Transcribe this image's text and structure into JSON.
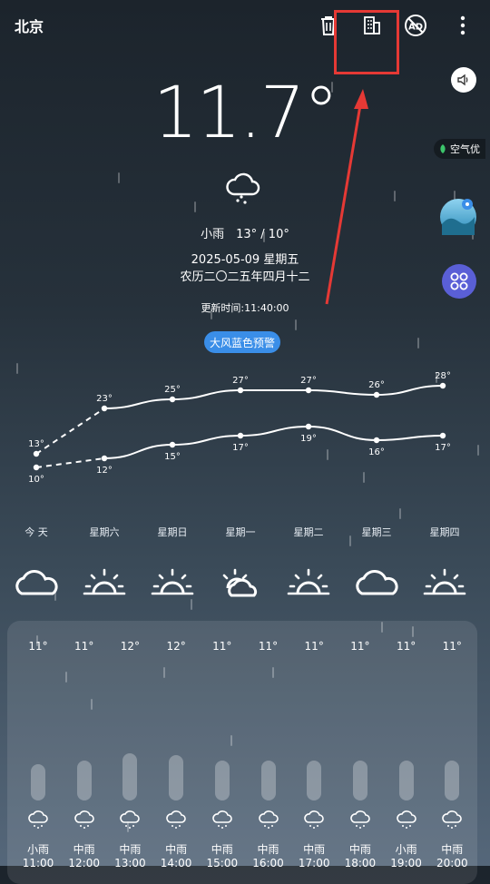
{
  "header": {
    "city": "北京",
    "icons": [
      "delete-icon",
      "building-icon",
      "ad-off-icon",
      "more-vert-icon"
    ]
  },
  "current": {
    "temperature": "11.7°",
    "condition_range": "小雨　13° / 10°",
    "date_weekday": "2025-05-09 星期五",
    "lunar": "农历二〇二五年四月十二",
    "updated": "更新时间:11:40:00",
    "warning": "大风蓝色预警",
    "air_quality": "空气优"
  },
  "daily": [
    {
      "label": "今 天",
      "high": "13°",
      "low": "10°",
      "icon": "cloud"
    },
    {
      "label": "星期六",
      "high": "23°",
      "low": "12°",
      "icon": "sun-cloud"
    },
    {
      "label": "星期日",
      "high": "25°",
      "low": "15°",
      "icon": "sun-cloud"
    },
    {
      "label": "星期一",
      "high": "27°",
      "low": "17°",
      "icon": "sun-cloud-partly"
    },
    {
      "label": "星期二",
      "high": "27°",
      "low": "19°",
      "icon": "sun-cloud"
    },
    {
      "label": "星期三",
      "high": "26°",
      "low": "16°",
      "icon": "cloud"
    },
    {
      "label": "星期四",
      "high": "28°",
      "low": "17°",
      "icon": "sun-cloud"
    }
  ],
  "chart_data": {
    "type": "line",
    "categories": [
      "今 天",
      "星期六",
      "星期日",
      "星期一",
      "星期二",
      "星期三",
      "星期四"
    ],
    "series": [
      {
        "values": [
          13,
          23,
          25,
          27,
          27,
          26,
          28
        ]
      },
      {
        "values": [
          10,
          12,
          15,
          17,
          19,
          16,
          17
        ]
      }
    ],
    "ylim": [
      8,
      30
    ]
  },
  "hourly": [
    {
      "temp": "11°",
      "desc": "小雨",
      "time": "11:00",
      "level": 0.5
    },
    {
      "temp": "11°",
      "desc": "中雨",
      "time": "12:00",
      "level": 0.55
    },
    {
      "temp": "12°",
      "desc": "中雨",
      "time": "13:00",
      "level": 0.65
    },
    {
      "temp": "12°",
      "desc": "中雨",
      "time": "14:00",
      "level": 0.62
    },
    {
      "temp": "11°",
      "desc": "中雨",
      "time": "15:00",
      "level": 0.55
    },
    {
      "temp": "11°",
      "desc": "中雨",
      "time": "16:00",
      "level": 0.55
    },
    {
      "temp": "11°",
      "desc": "中雨",
      "time": "17:00",
      "level": 0.55
    },
    {
      "temp": "11°",
      "desc": "中雨",
      "time": "18:00",
      "level": 0.55
    },
    {
      "temp": "11°",
      "desc": "小雨",
      "time": "19:00",
      "level": 0.55
    },
    {
      "temp": "11°",
      "desc": "中雨",
      "time": "20:00",
      "level": 0.55
    }
  ],
  "colors": {
    "highlight": "#e53935",
    "warning_bg": "#3a8ee8",
    "side_app_bg": "#5a5fd6"
  }
}
